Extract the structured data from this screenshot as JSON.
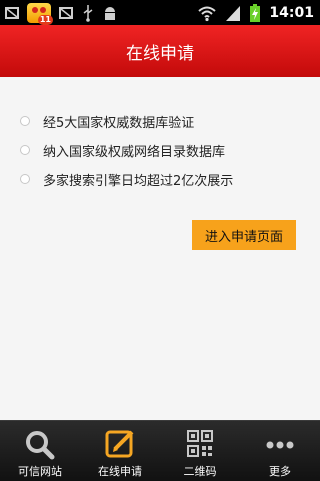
{
  "status_bar": {
    "time": "14:01",
    "notification_count": "11",
    "icons": [
      "image-icon",
      "app-notification-icon",
      "image-icon",
      "usb-icon",
      "android-debug-icon",
      "wifi-icon",
      "signal-icon",
      "battery-charging-icon"
    ]
  },
  "header": {
    "title": "在线申请"
  },
  "features": [
    {
      "text": "经5大国家权威数据库验证"
    },
    {
      "text": "纳入国家级权威网络目录数据库"
    },
    {
      "text": "多家搜索引擎日均超过2亿次展示"
    }
  ],
  "enter_button": {
    "label": "进入申请页面"
  },
  "tabs": [
    {
      "label": "可信网站",
      "icon": "search-icon",
      "active": false
    },
    {
      "label": "在线申请",
      "icon": "edit-icon",
      "active": true
    },
    {
      "label": "二维码",
      "icon": "qr-code-icon",
      "active": false
    },
    {
      "label": "更多",
      "icon": "more-icon",
      "active": false
    }
  ],
  "colors": {
    "header_red": "#e01818",
    "button_orange": "#f7a21b",
    "active_tab": "#f5a623"
  }
}
